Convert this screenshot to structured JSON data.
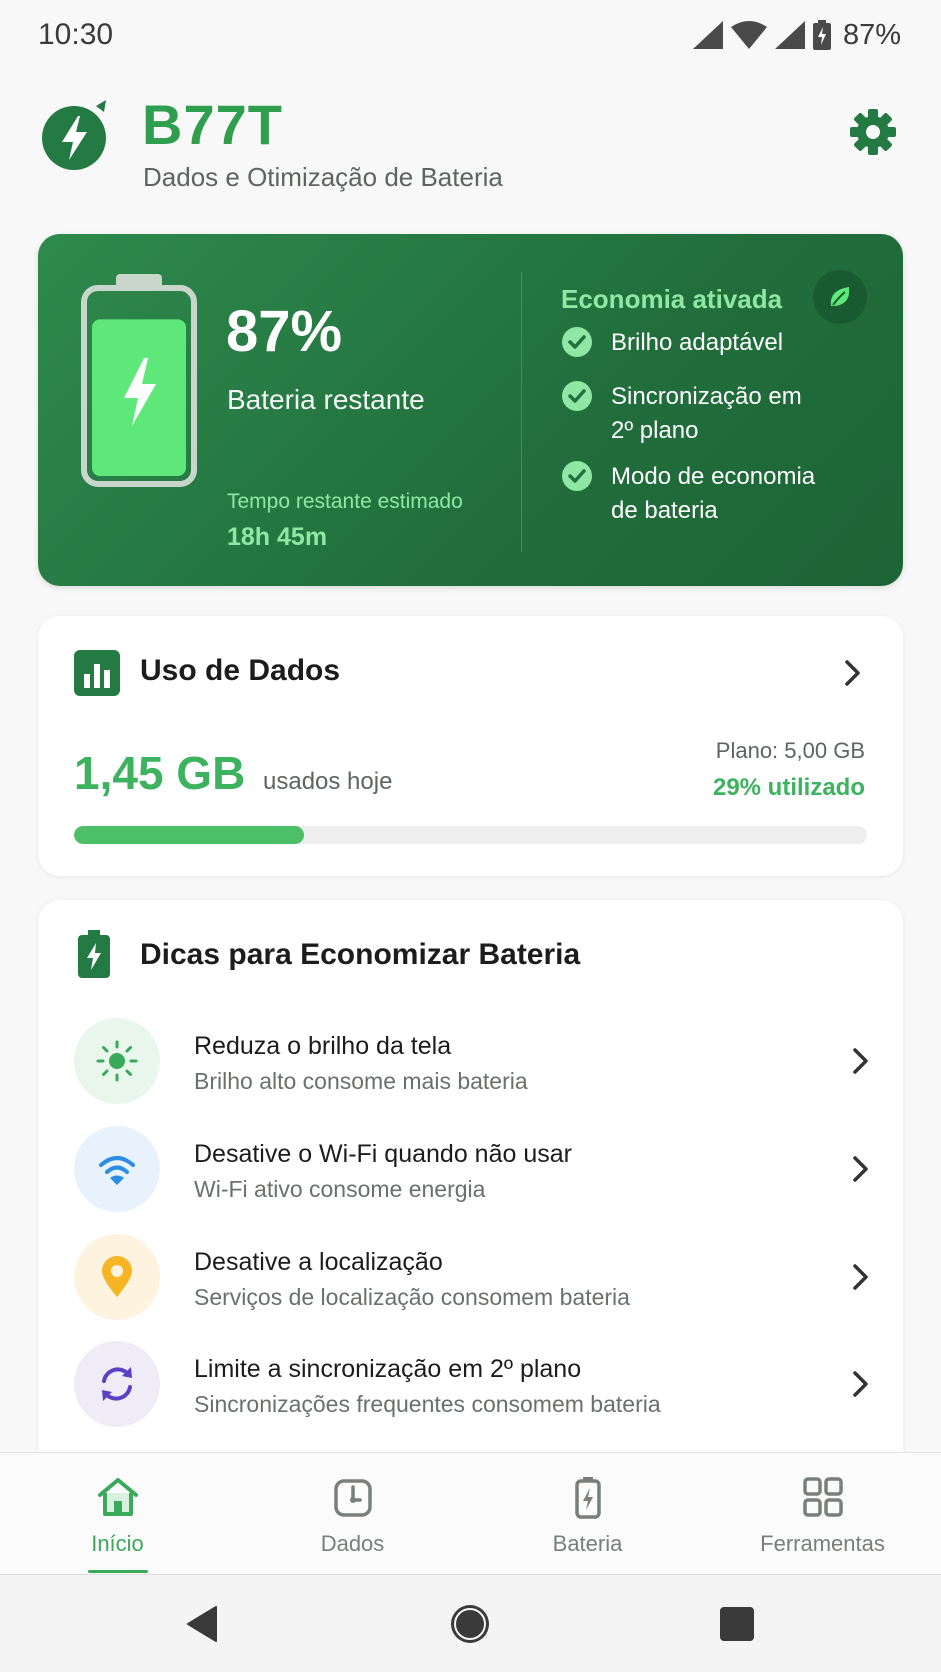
{
  "status_bar": {
    "time": "10:30",
    "battery_pct": "87%",
    "icons": [
      "signal-icon",
      "wifi-icon",
      "signal-icon",
      "battery-icon"
    ]
  },
  "header": {
    "title": "B77T",
    "subtitle": "Dados e Otimização de Bateria",
    "logo_icon": "bolt-icon",
    "settings_icon": "gear-icon"
  },
  "battery_card": {
    "level_fraction": 0.87,
    "percent": "87%",
    "label": "Bateria restante",
    "time_label": "Tempo restante estimado",
    "time_value": "18h 45m",
    "eco_title": "Economia ativada",
    "eco_icon": "leaf-icon",
    "eco_items": [
      {
        "label": "Brilho adaptável",
        "icon": "check-icon"
      },
      {
        "label": "Sincronização em 2º plano",
        "icon": "check-icon"
      },
      {
        "label": "Modo de economia de bateria",
        "icon": "check-icon"
      }
    ]
  },
  "data_card": {
    "title": "Uso de Dados",
    "icon": "bar-chart-icon",
    "amount": "1,45 GB",
    "amount_suffix": "usados hoje",
    "plan": "Plano: 5,00 GB",
    "used_pct": "29% utilizado",
    "used_fraction": 0.29
  },
  "tips_card": {
    "title": "Dicas para Economizar Bateria",
    "icon": "battery-bolt-icon",
    "items": [
      {
        "title": "Reduza o brilho da tela",
        "subtitle": "Brilho alto consome mais bateria",
        "icon": "sun-icon",
        "bg": "#e9f6ec"
      },
      {
        "title": "Desative o Wi-Fi quando não usar",
        "subtitle": "Wi-Fi ativo consome energia",
        "icon": "wifi-icon",
        "bg": "#e8f2fc"
      },
      {
        "title": "Desative a localização",
        "subtitle": "Serviços de localização consomem bateria",
        "icon": "location-pin-icon",
        "bg": "#fdf3df"
      },
      {
        "title": "Limite a sincronização em 2º plano",
        "subtitle": "Sincronizações frequentes consomem bateria",
        "icon": "sync-icon",
        "bg": "#efecf8"
      }
    ]
  },
  "bottom_nav": {
    "items": [
      {
        "label": "Início",
        "icon": "home-icon",
        "active": true
      },
      {
        "label": "Dados",
        "icon": "data-usage-icon",
        "active": false
      },
      {
        "label": "Bateria",
        "icon": "battery-icon",
        "active": false
      },
      {
        "label": "Ferramentas",
        "icon": "grid-icon",
        "active": false
      }
    ]
  },
  "system_nav": [
    "back-icon",
    "home-circle-icon",
    "recents-icon"
  ],
  "colors": {
    "accent": "#2f9e4f",
    "accent_light": "#8fe7a3",
    "card_green": "#236f3f",
    "progress": "#4cbf68"
  }
}
